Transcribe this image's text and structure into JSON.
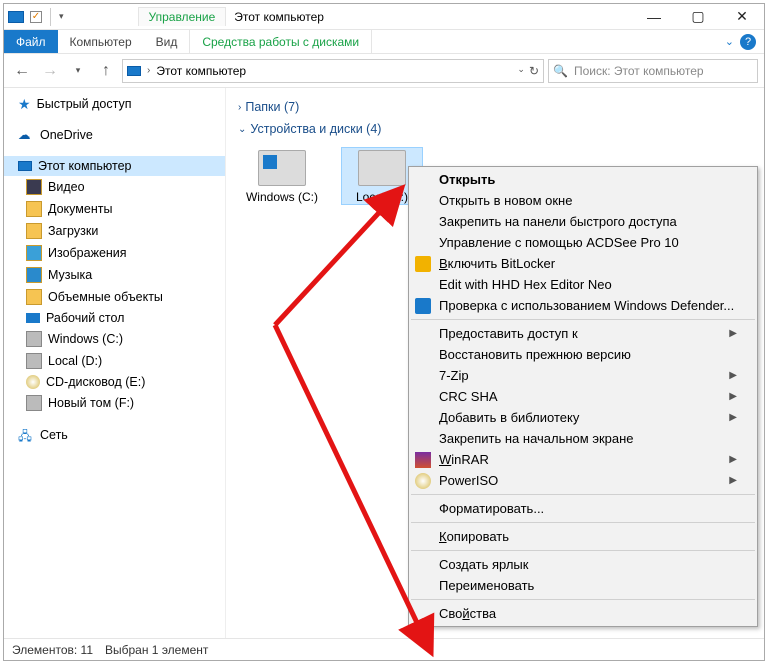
{
  "title_tab": "Управление",
  "title_label": "Этот компьютер",
  "ribbon": {
    "file": "Файл",
    "computer": "Компьютер",
    "view": "Вид",
    "context_tab": "Средства работы с дисками"
  },
  "address": {
    "path": "Этот компьютер"
  },
  "search": {
    "placeholder": "Поиск: Этот компьютер"
  },
  "sidebar": {
    "quick": "Быстрый доступ",
    "onedrive": "OneDrive",
    "thispc": "Этот компьютер",
    "items": [
      "Видео",
      "Документы",
      "Загрузки",
      "Изображения",
      "Музыка",
      "Объемные объекты",
      "Рабочий стол",
      "Windows (C:)",
      "Local (D:)",
      "CD-дисковод (E:)",
      "Новый том (F:)"
    ],
    "network": "Сеть"
  },
  "content": {
    "folders_header": "Папки (7)",
    "drives_header": "Устройства и диски (4)",
    "drives": [
      {
        "label": "Windows (C:)"
      },
      {
        "label": "Local (D:)"
      }
    ]
  },
  "status": {
    "count": "Элементов: 11",
    "sel": "Выбран 1 элемент"
  },
  "menu": {
    "open": "Открыть",
    "open_new": "Открыть в новом окне",
    "pin_quick": "Закрепить на панели быстрого доступа",
    "acdsee": "Управление с помощью ACDSee Pro 10",
    "bitlocker": "Включить BitLocker",
    "hexeditor": "Edit with HHD Hex Editor Neo",
    "defender": "Проверка с использованием Windows Defender...",
    "share": "Предоставить доступ к",
    "restore": "Восстановить прежнюю версию",
    "sevenzip": "7-Zip",
    "crcsha": "CRC SHA",
    "library": "Добавить в библиотеку",
    "pin_start": "Закрепить на начальном экране",
    "winrar": "WinRAR",
    "poweriso": "PowerISO",
    "format": "Форматировать...",
    "copy": "Копировать",
    "shortcut": "Создать ярлык",
    "rename": "Переименовать",
    "properties": "Свойства"
  }
}
